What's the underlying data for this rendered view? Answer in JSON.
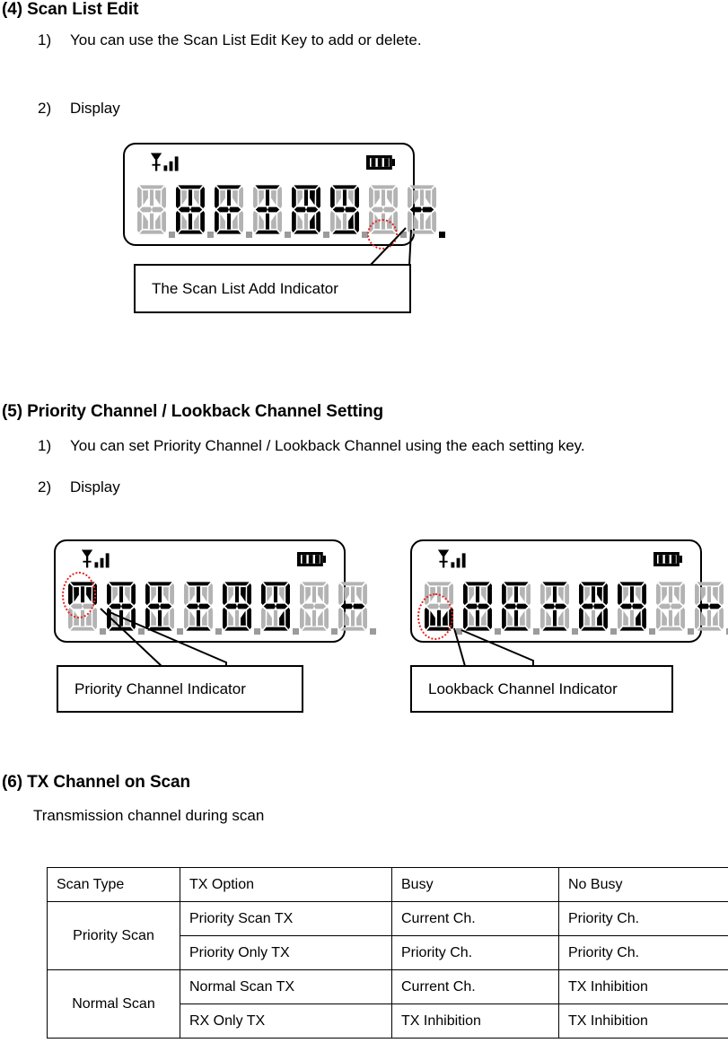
{
  "sections": [
    {
      "id": "scan-list-edit",
      "title": "(4) Scan List Edit",
      "item1_num": "1)",
      "item1_text": "You can use the Scan List Edit Key to add or delete.",
      "item2_num": "2)",
      "item2_text": "Display",
      "callout": "The Scan List Add Indicator"
    },
    {
      "id": "priority-lookback",
      "title": "(5) Priority Channel / Lookback Channel Setting",
      "item1_num": "1)",
      "item1_text": "You can set Priority Channel / Lookback Channel using the each setting key.",
      "item2_num": "2)",
      "item2_text": "Display",
      "callout_left": "Priority Channel Indicator",
      "callout_right": "Lookback Channel Indicator"
    },
    {
      "id": "tx-channel-on-scan",
      "title": "(6) TX Channel on Scan",
      "subtitle": "Transmission channel during scan"
    }
  ],
  "lcd": {
    "signal_icon": "signal-bars-icon",
    "battery_icon": "battery-icon",
    "cell_count": 8,
    "displays": {
      "scan_list": {
        "name": "scan-list-lcd",
        "indicator": "add-dot",
        "indicator_state": "on"
      },
      "priority": {
        "name": "priority-channel-lcd",
        "indicator": "priority-triangle-down",
        "indicator_state": "on"
      },
      "lookback": {
        "name": "lookback-channel-lcd",
        "indicator": "lookback-triangle-up",
        "indicator_state": "on"
      }
    }
  },
  "colors": {
    "highlight": "#e8241f",
    "segment_on": "#000000",
    "segment_off": "#b3b3b3",
    "segment_dim": "#8c8c8c",
    "ink": "#000000",
    "paper": "#ffffff"
  },
  "table": {
    "headers": [
      "Scan Type",
      "TX Option",
      "Busy",
      "No Busy"
    ],
    "groups": [
      {
        "scan_type": "Priority Scan",
        "rows": [
          {
            "tx_option": "Priority Scan TX",
            "busy": "Current Ch.",
            "no_busy": "Priority Ch."
          },
          {
            "tx_option": "Priority Only TX",
            "busy": "Priority Ch.",
            "no_busy": "Priority Ch."
          }
        ]
      },
      {
        "scan_type": "Normal Scan",
        "rows": [
          {
            "tx_option": "Normal Scan TX",
            "busy": "Current Ch.",
            "no_busy": "TX Inhibition"
          },
          {
            "tx_option": "RX Only TX",
            "busy": "TX Inhibition",
            "no_busy": "TX Inhibition"
          }
        ]
      }
    ]
  }
}
